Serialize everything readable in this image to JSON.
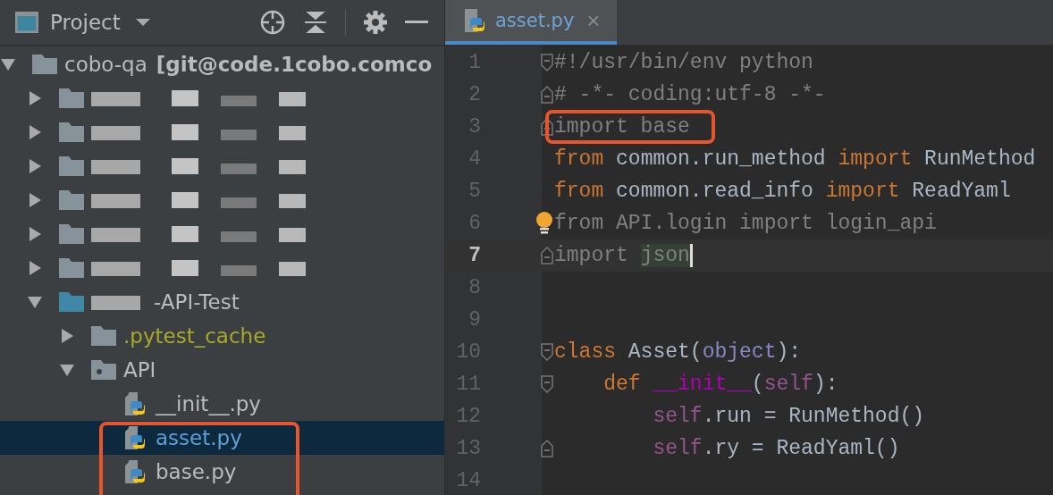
{
  "project_panel": {
    "title": "Project"
  },
  "tree": [
    {
      "name": "cobo-qa",
      "vcs": "[git@code.1cobo.comco",
      "kind": "folder",
      "expanded": true,
      "selected": false,
      "children": [
        {
          "kind": "folder",
          "redacted": true,
          "expanded": false,
          "selected": false
        },
        {
          "kind": "folder",
          "redacted": true,
          "expanded": false,
          "selected": false
        },
        {
          "kind": "folder",
          "redacted": true,
          "expanded": false,
          "selected": false
        },
        {
          "kind": "folder",
          "redacted": true,
          "expanded": false,
          "selected": false
        },
        {
          "kind": "folder",
          "redacted": true,
          "expanded": false,
          "selected": false
        },
        {
          "kind": "folder",
          "redacted": true,
          "expanded": false,
          "selected": false
        },
        {
          "name": "-API-Test",
          "kind": "module",
          "redacted": true,
          "expanded": true,
          "selected": false,
          "children": [
            {
              "name": ".pytest_cache",
              "kind": "folder",
              "excluded": true,
              "expanded": false,
              "selected": false
            },
            {
              "name": "API",
              "kind": "package",
              "expanded": true,
              "selected": false,
              "children": [
                {
                  "name": "__init__.py",
                  "kind": "file",
                  "selected": false
                },
                {
                  "name": "asset.py",
                  "kind": "file",
                  "selected": true,
                  "annotated": true
                },
                {
                  "name": "base.py",
                  "kind": "file",
                  "selected": false,
                  "annotated": true
                }
              ]
            }
          ]
        }
      ]
    }
  ],
  "editor_tab": {
    "label": "asset.py",
    "close": "×",
    "selected": true
  },
  "lines": [
    {
      "number": "1",
      "fold_start": true,
      "tokens": [
        {
          "kind": "comment",
          "text": "#!/usr/bin/env python"
        }
      ]
    },
    {
      "number": "2",
      "fold_end": true,
      "tokens": [
        {
          "kind": "comment",
          "text": "# -*- coding:utf-8 -*-"
        }
      ]
    },
    {
      "number": "3",
      "fold_end": true,
      "annotated": true,
      "tokens": [
        {
          "kind": "unused",
          "text": "import base"
        }
      ]
    },
    {
      "number": "4",
      "tokens": [
        {
          "kind": "keyword",
          "text": "from"
        },
        {
          "kind": "plain",
          "text": " common.run_method "
        },
        {
          "kind": "keyword",
          "text": "import"
        },
        {
          "kind": "plain",
          "text": " RunMethod"
        }
      ]
    },
    {
      "number": "5",
      "tokens": [
        {
          "kind": "keyword",
          "text": "from"
        },
        {
          "kind": "plain",
          "text": " common.read_info "
        },
        {
          "kind": "keyword",
          "text": "import"
        },
        {
          "kind": "plain",
          "text": " ReadYaml"
        }
      ]
    },
    {
      "number": "6",
      "bulb": true,
      "tokens": [
        {
          "kind": "unused",
          "text": "from API.login import login_api"
        }
      ]
    },
    {
      "number": "7",
      "fold_end": true,
      "current": true,
      "caret": true,
      "tokens": [
        {
          "kind": "unused",
          "text": "import "
        },
        {
          "kind": "unused-marked",
          "text": "json"
        }
      ]
    },
    {
      "number": "8"
    },
    {
      "number": "9"
    },
    {
      "number": "10",
      "fold_start": true,
      "tokens": [
        {
          "kind": "keyword",
          "text": "class"
        },
        {
          "kind": "plain",
          "text": " Asset("
        },
        {
          "kind": "builtin",
          "text": "object"
        },
        {
          "kind": "plain",
          "text": "):"
        }
      ]
    },
    {
      "number": "11",
      "fold_start": true,
      "tokens": [
        {
          "kind": "keyword",
          "text": "    def "
        },
        {
          "kind": "magic",
          "text": "__init__"
        },
        {
          "kind": "plain",
          "text": "("
        },
        {
          "kind": "self",
          "text": "self"
        },
        {
          "kind": "plain",
          "text": "):"
        }
      ]
    },
    {
      "number": "12",
      "tokens": [
        {
          "kind": "self",
          "text": "        self"
        },
        {
          "kind": "plain",
          "text": ".run = RunMethod()"
        }
      ]
    },
    {
      "number": "13",
      "fold_end": true,
      "tokens": [
        {
          "kind": "self",
          "text": "        self"
        },
        {
          "kind": "plain",
          "text": ".ry = ReadYaml()"
        }
      ]
    },
    {
      "number": "14"
    }
  ]
}
